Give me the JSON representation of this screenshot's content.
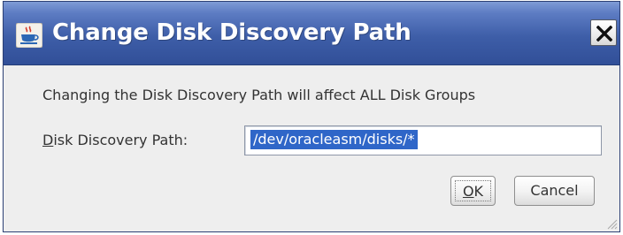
{
  "window": {
    "title": "Change Disk Discovery Path",
    "icon": "java-cup-icon",
    "close_icon": "close-icon"
  },
  "content": {
    "message": "Changing the Disk Discovery Path will affect ALL Disk Groups",
    "path_label_mnemonic": "D",
    "path_label_rest": "isk Discovery Path:",
    "path_value": "/dev/oracleasm/disks/*"
  },
  "buttons": {
    "ok_mnemonic": "O",
    "ok_rest": "K",
    "cancel": "Cancel"
  },
  "colors": {
    "titlebar": "#3e5ea8",
    "selection": "#2f66c8",
    "background": "#eeeeee"
  }
}
